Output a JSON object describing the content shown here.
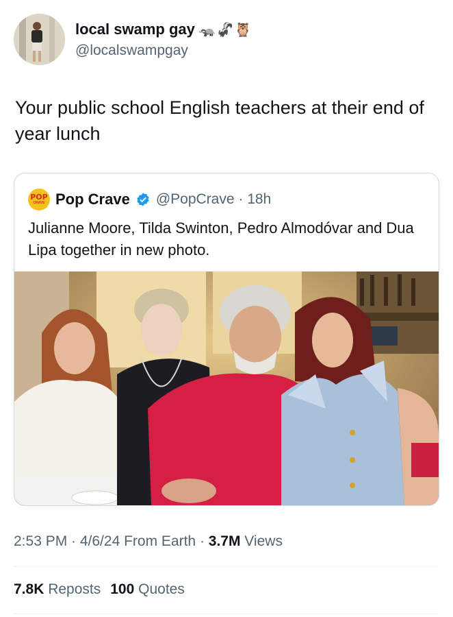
{
  "author": {
    "display_name": "local swamp gay",
    "emojis": "🦡🦨🦉",
    "handle": "@localswampgay",
    "avatar_icon": "person-photo-avatar"
  },
  "tweet": {
    "text": "Your public school English teachers at their end of year lunch"
  },
  "quoted": {
    "logo_line1": "POP",
    "logo_line2": "CRAVE",
    "display_name": "Pop Crave",
    "handle_time": "@PopCrave · 18h",
    "text": "Julianne Moore, Tilda Swinton, Pedro Almodóvar and Dua Lipa together in new photo.",
    "verified_color": "#1d9bf0"
  },
  "meta": {
    "timestamp": "2:53 PM · 4/6/24 From Earth · ",
    "views_count": "3.7M",
    "views_label": " Views"
  },
  "stats": {
    "reposts_count": "7.8K",
    "reposts_label": "Reposts",
    "quotes_count": "100",
    "quotes_label": "Quotes"
  }
}
